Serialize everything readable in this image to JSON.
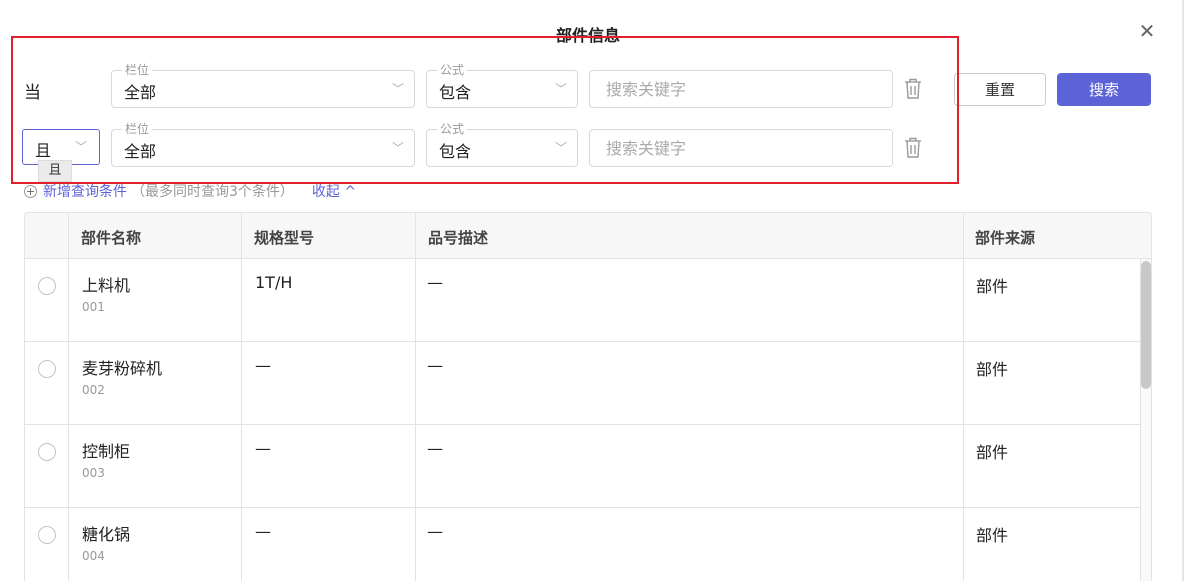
{
  "dialog": {
    "title": "部件信息",
    "close_icon": "✕"
  },
  "conditions": [
    {
      "connector": "当",
      "field_legend": "栏位",
      "field_value": "全部",
      "formula_legend": "公式",
      "formula_value": "包含",
      "keyword_placeholder": "搜索关键字"
    },
    {
      "connector": "且",
      "field_legend": "栏位",
      "field_value": "全部",
      "formula_legend": "公式",
      "formula_value": "包含",
      "keyword_placeholder": "搜索关键字"
    }
  ],
  "connector_tooltip": "且",
  "actions": {
    "reset_label": "重置",
    "search_label": "搜索"
  },
  "add_condition": {
    "link": "新增查询条件",
    "hint": "（最多同时查询3个条件）",
    "collapse": "收起"
  },
  "table": {
    "columns": [
      "部件名称",
      "规格型号",
      "品号描述",
      "部件来源"
    ],
    "rows": [
      {
        "name": "上料机",
        "code": "001",
        "spec": "1T/H",
        "desc": "—",
        "source": "部件"
      },
      {
        "name": "麦芽粉碎机",
        "code": "002",
        "spec": "—",
        "desc": "—",
        "source": "部件"
      },
      {
        "name": "控制柜",
        "code": "003",
        "spec": "—",
        "desc": "—",
        "source": "部件"
      },
      {
        "name": "糖化锅",
        "code": "004",
        "spec": "—",
        "desc": "—",
        "source": "部件"
      }
    ]
  },
  "colors": {
    "accent": "#5c63d6",
    "highlight_border": "#e0202a"
  }
}
